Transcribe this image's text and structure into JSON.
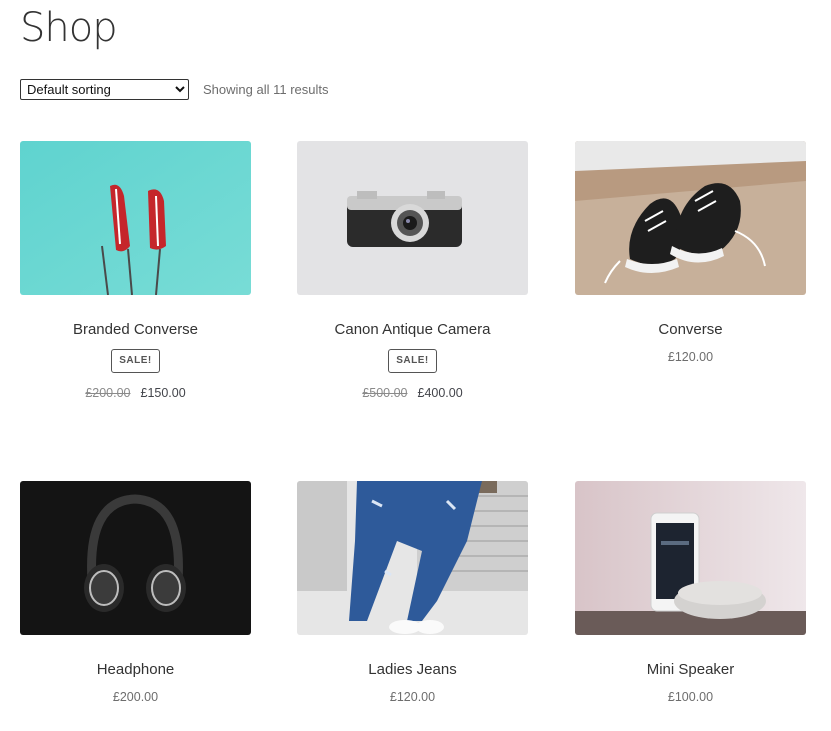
{
  "page": {
    "title": "Shop"
  },
  "toolbar": {
    "sort_selected": "Default sorting",
    "result_count": "Showing all 11 results"
  },
  "products": [
    {
      "name": "Branded Converse",
      "badge": "SALE!",
      "old_price": "£200.00",
      "price": "£150.00",
      "image": "red-sneakers-on-sticks"
    },
    {
      "name": "Canon Antique Camera",
      "badge": "SALE!",
      "old_price": "£500.00",
      "price": "£400.00",
      "image": "vintage-camera"
    },
    {
      "name": "Converse",
      "price": "£120.00",
      "image": "black-converse-shoes"
    },
    {
      "name": "Headphone",
      "price": "£200.00",
      "image": "black-headphones"
    },
    {
      "name": "Ladies Jeans",
      "price": "£120.00",
      "image": "ripped-blue-jeans"
    },
    {
      "name": "Mini Speaker",
      "price": "£100.00",
      "image": "phone-and-speaker"
    }
  ]
}
